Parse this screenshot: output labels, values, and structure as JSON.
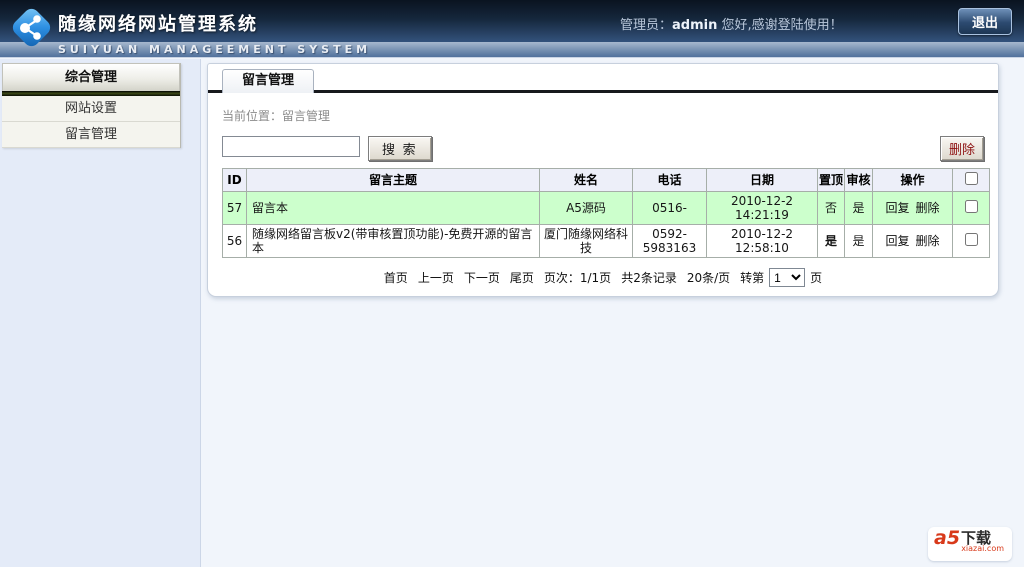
{
  "header": {
    "title": "随缘网络网站管理系统",
    "subtitle": "SUIYUAN MANAGEEMENT SYSTEM",
    "admin_label": "管理员：",
    "admin_name": "admin",
    "greeting": "您好,感谢登陆使用！",
    "logout_label": "退出"
  },
  "sidebar": {
    "section_title": "综合管理",
    "items": [
      {
        "label": "网站设置"
      },
      {
        "label": "留言管理"
      }
    ]
  },
  "main": {
    "tab_label": "留言管理",
    "breadcrumb": "当前位置：留言管理",
    "search_button": "搜 索",
    "delete_button": "删除",
    "table": {
      "headers": [
        "ID",
        "留言主题",
        "姓名",
        "电话",
        "日期",
        "置顶",
        "审核",
        "操作"
      ],
      "rows": [
        {
          "id": "57",
          "subject": "留言本",
          "name": "A5源码",
          "phone": "0516-",
          "date": "2010-12-2 14:21:19",
          "top": "否",
          "audit": "是",
          "reply_label": "回复",
          "delete_label": "删除"
        },
        {
          "id": "56",
          "subject": "随缘网络留言板v2(带审核置顶功能)-免费开源的留言本",
          "name": "厦门随缘网络科技",
          "phone": "0592-5983163",
          "date": "2010-12-2 12:58:10",
          "top": "是",
          "audit": "是",
          "reply_label": "回复",
          "delete_label": "删除"
        }
      ]
    },
    "pagination": {
      "first": "首页",
      "prev": "上一页",
      "next": "下一页",
      "last": "尾页",
      "page_info": "页次：1/1页",
      "total": "共2条记录",
      "per_page": "20条/页",
      "goto_prefix": "转第",
      "goto_value": "1",
      "goto_suffix": "页"
    }
  },
  "footer_logo": {
    "brand": "a5",
    "text": "下载",
    "domain": "xiazai.com"
  },
  "colors": {
    "header_navy": "#15273c",
    "logo_blue": "#2d8fe2",
    "row_green": "#ccffcc",
    "flag_red": "#cc0000"
  }
}
